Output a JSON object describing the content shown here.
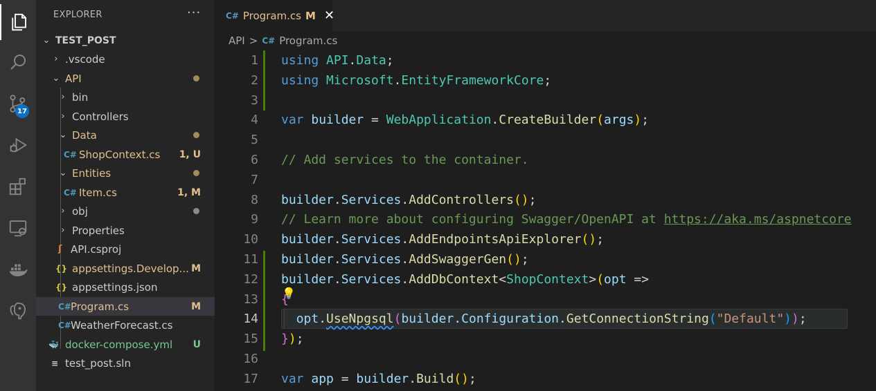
{
  "activity_bar": {
    "items": [
      "explorer-icon",
      "search-icon",
      "source-control-icon",
      "run-debug-icon",
      "extensions-icon",
      "remote-explorer-icon",
      "docker-icon",
      "postgres-icon"
    ],
    "source_control_badge": "17"
  },
  "sidebar": {
    "title": "EXPLORER",
    "more": "···",
    "root": "TEST_POST",
    "items": [
      {
        "label": ".vscode"
      },
      {
        "label": "API"
      },
      {
        "label": "bin"
      },
      {
        "label": "Controllers"
      },
      {
        "label": "Data"
      },
      {
        "label": "ShopContext.cs",
        "status": "1, U"
      },
      {
        "label": "Entities"
      },
      {
        "label": "Item.cs",
        "status": "1, M"
      },
      {
        "label": "obj"
      },
      {
        "label": "Properties"
      },
      {
        "label": "API.csproj"
      },
      {
        "label": "appsettings.Develop...",
        "status": "M"
      },
      {
        "label": "appsettings.json"
      },
      {
        "label": "Program.cs",
        "status": "M"
      },
      {
        "label": "WeatherForecast.cs"
      },
      {
        "label": "docker-compose.yml",
        "status": "U"
      },
      {
        "label": "test_post.sln"
      }
    ]
  },
  "tab": {
    "icon": "C#",
    "name": "Program.cs",
    "modified": "M",
    "close": "✕"
  },
  "breadcrumb": {
    "folder": "API",
    "separator": ">",
    "icon": "C#",
    "file": "Program.cs"
  },
  "editor": {
    "active_line": 14,
    "lines": [
      {
        "n": "1",
        "tokens": [
          [
            "kw",
            "using"
          ],
          [
            "p",
            " "
          ],
          [
            "ns",
            "API"
          ],
          [
            "p",
            "."
          ],
          [
            "ns",
            "Data"
          ],
          [
            "p",
            ";"
          ]
        ]
      },
      {
        "n": "2",
        "tokens": [
          [
            "kw",
            "using"
          ],
          [
            "p",
            " "
          ],
          [
            "ns",
            "Microsoft"
          ],
          [
            "p",
            "."
          ],
          [
            "ty",
            "EntityFrameworkCore"
          ],
          [
            "p",
            ";"
          ]
        ]
      },
      {
        "n": "3",
        "tokens": []
      },
      {
        "n": "4",
        "tokens": [
          [
            "kw",
            "var"
          ],
          [
            "p",
            " "
          ],
          [
            "var",
            "builder"
          ],
          [
            "p",
            " = "
          ],
          [
            "ty",
            "WebApplication"
          ],
          [
            "p",
            "."
          ],
          [
            "fn",
            "CreateBuilder"
          ],
          [
            "br",
            "("
          ],
          [
            "var",
            "args"
          ],
          [
            "br",
            ")"
          ],
          [
            "p",
            ";"
          ]
        ]
      },
      {
        "n": "5",
        "tokens": []
      },
      {
        "n": "6",
        "tokens": [
          [
            "cm",
            "// Add services to the container."
          ]
        ]
      },
      {
        "n": "7",
        "tokens": []
      },
      {
        "n": "8",
        "tokens": [
          [
            "var",
            "builder"
          ],
          [
            "p",
            "."
          ],
          [
            "var",
            "Services"
          ],
          [
            "p",
            "."
          ],
          [
            "fn",
            "AddControllers"
          ],
          [
            "br",
            "()"
          ],
          [
            "p",
            ";"
          ]
        ]
      },
      {
        "n": "9",
        "tokens": [
          [
            "cm",
            "// Learn more about configuring Swagger/OpenAPI at "
          ],
          [
            "cmlink",
            "https://aka.ms/aspnetcore"
          ]
        ]
      },
      {
        "n": "10",
        "tokens": [
          [
            "var",
            "builder"
          ],
          [
            "p",
            "."
          ],
          [
            "var",
            "Services"
          ],
          [
            "p",
            "."
          ],
          [
            "fn",
            "AddEndpointsApiExplorer"
          ],
          [
            "br",
            "()"
          ],
          [
            "p",
            ";"
          ]
        ]
      },
      {
        "n": "11",
        "tokens": [
          [
            "var",
            "builder"
          ],
          [
            "p",
            "."
          ],
          [
            "var",
            "Services"
          ],
          [
            "p",
            "."
          ],
          [
            "fn",
            "AddSwaggerGen"
          ],
          [
            "br",
            "()"
          ],
          [
            "p",
            ";"
          ]
        ]
      },
      {
        "n": "12",
        "tokens": [
          [
            "var",
            "builder"
          ],
          [
            "p",
            "."
          ],
          [
            "var",
            "Services"
          ],
          [
            "p",
            "."
          ],
          [
            "fn",
            "AddDbContext"
          ],
          [
            "p",
            "<"
          ],
          [
            "ty",
            "ShopContext"
          ],
          [
            "p",
            ">"
          ],
          [
            "br",
            "("
          ],
          [
            "var",
            "opt"
          ],
          [
            "p",
            " =>"
          ]
        ]
      },
      {
        "n": "13",
        "tokens": [
          [
            "br2",
            "{"
          ]
        ]
      },
      {
        "n": "14",
        "tokens": [
          [
            "p",
            "  "
          ],
          [
            "var",
            "opt"
          ],
          [
            "p",
            "."
          ],
          [
            "fnsq",
            "UseNpgsql"
          ],
          [
            "br2",
            "("
          ],
          [
            "var",
            "builder"
          ],
          [
            "p",
            "."
          ],
          [
            "var",
            "Configuration"
          ],
          [
            "p",
            "."
          ],
          [
            "fn",
            "GetConnectionString"
          ],
          [
            "br3",
            "("
          ],
          [
            "str",
            "\"Default\""
          ],
          [
            "br3",
            ")"
          ],
          [
            "br2",
            ")"
          ],
          [
            "p",
            ";"
          ]
        ]
      },
      {
        "n": "15",
        "tokens": [
          [
            "br2",
            "}"
          ],
          [
            "br",
            ")"
          ],
          [
            "p",
            ";"
          ]
        ]
      },
      {
        "n": "16",
        "tokens": []
      },
      {
        "n": "17",
        "tokens": [
          [
            "kw",
            "var"
          ],
          [
            "p",
            " "
          ],
          [
            "var",
            "app"
          ],
          [
            "p",
            " = "
          ],
          [
            "var",
            "builder"
          ],
          [
            "p",
            "."
          ],
          [
            "fn",
            "Build"
          ],
          [
            "br",
            "()"
          ],
          [
            "p",
            ";"
          ]
        ]
      }
    ],
    "colors": {
      "kw": "#569cd6",
      "ns": "#4ec9b0",
      "ty": "#4ec9b0",
      "var": "#9cdcfe",
      "fn": "#dcdcaa",
      "fnsq": "#dcdcaa",
      "p": "#d4d4d4",
      "br": "#ffd700",
      "br2": "#da70d6",
      "br3": "#179fff",
      "cm": "#6a9955",
      "cmlink": "#6a9955",
      "str": "#ce9178"
    },
    "lightbulb": "💡"
  }
}
